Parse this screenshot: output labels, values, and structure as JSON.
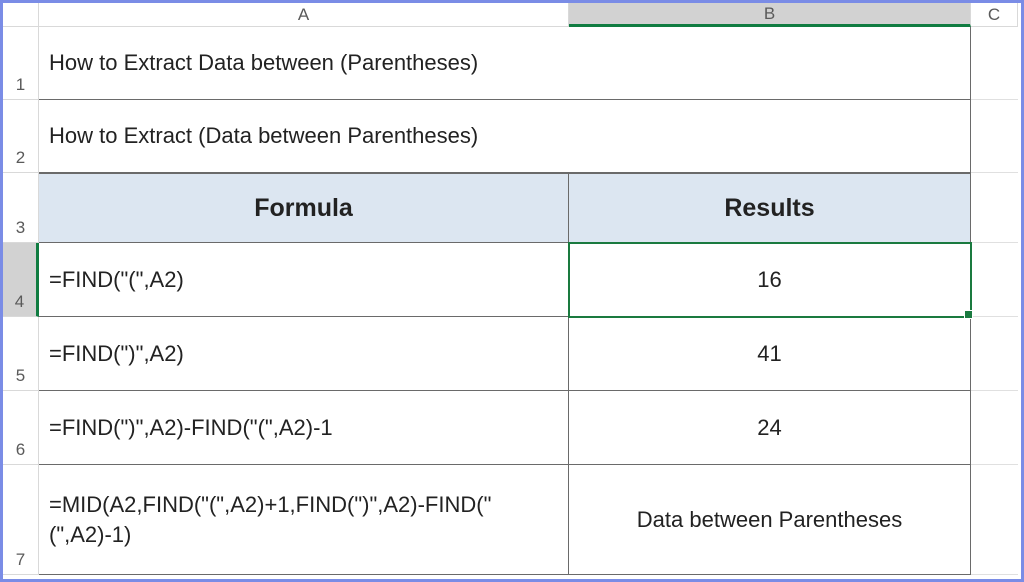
{
  "columns": {
    "A": "A",
    "B": "B",
    "C": "C"
  },
  "rows": {
    "r1": "1",
    "r2": "2",
    "r3": "3",
    "r4": "4",
    "r5": "5",
    "r6": "6",
    "r7": "7"
  },
  "cells": {
    "A1": "How to Extract Data between (Parentheses)",
    "A2": "How to Extract (Data between Parentheses)",
    "A3": "Formula",
    "B3": "Results",
    "A4": "=FIND(\"(\",A2)",
    "B4": "16",
    "A5": "=FIND(\")\",A2)",
    "B5": "41",
    "A6": "=FIND(\")\",A2)-FIND(\"(\",A2)-1",
    "B6": "24",
    "A7": "=MID(A2,FIND(\"(\",A2)+1,FIND(\")\",A2)-FIND(\"(\",A2)-1)",
    "B7": "Data between Parentheses"
  },
  "active_cell": "B4"
}
